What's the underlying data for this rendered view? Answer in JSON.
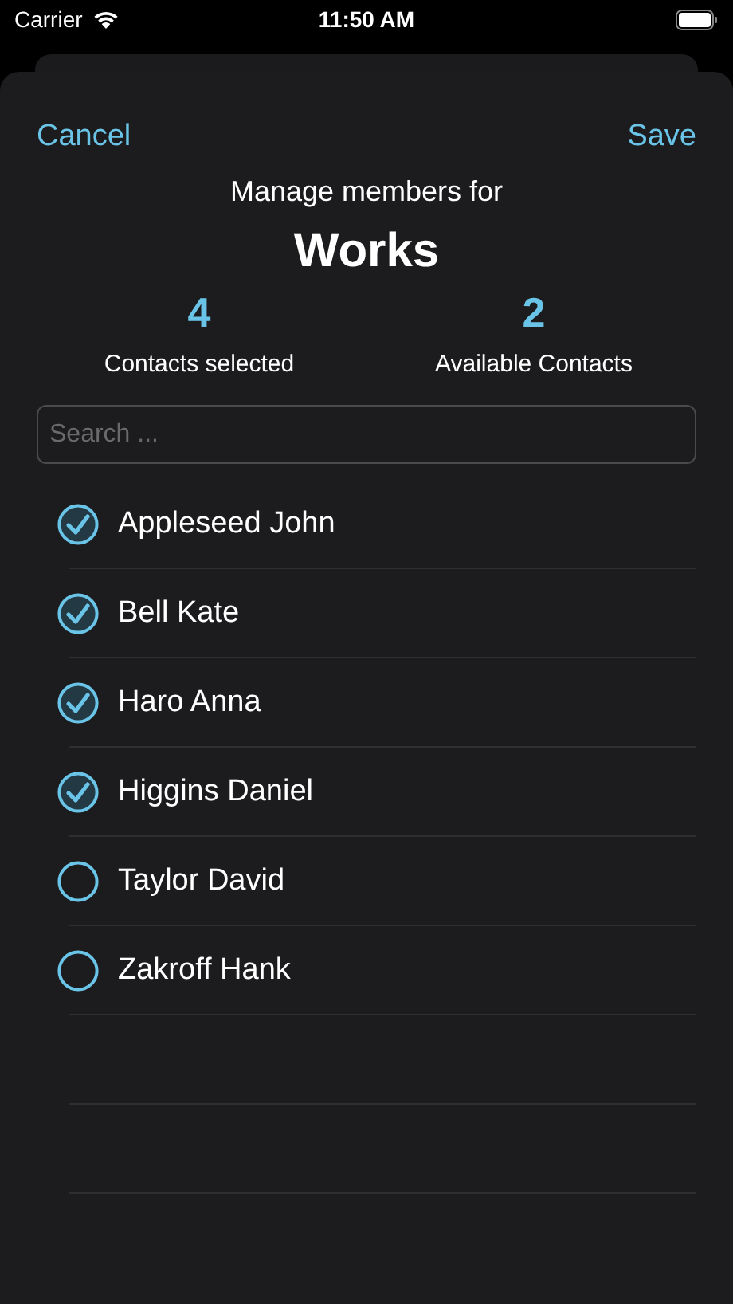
{
  "status_bar": {
    "carrier": "Carrier",
    "time": "11:50 AM"
  },
  "nav": {
    "cancel": "Cancel",
    "save": "Save"
  },
  "header": {
    "subtitle": "Manage members for",
    "title": "Works"
  },
  "stats": [
    {
      "value": "4",
      "label": "Contacts selected"
    },
    {
      "value": "2",
      "label": "Available Contacts"
    }
  ],
  "search": {
    "placeholder": "Search ..."
  },
  "contacts": [
    {
      "name": "Appleseed John",
      "selected": true
    },
    {
      "name": "Bell Kate",
      "selected": true
    },
    {
      "name": "Haro Anna",
      "selected": true
    },
    {
      "name": "Higgins Daniel",
      "selected": true
    },
    {
      "name": "Taylor David",
      "selected": false
    },
    {
      "name": "Zakroff Hank",
      "selected": false
    }
  ]
}
